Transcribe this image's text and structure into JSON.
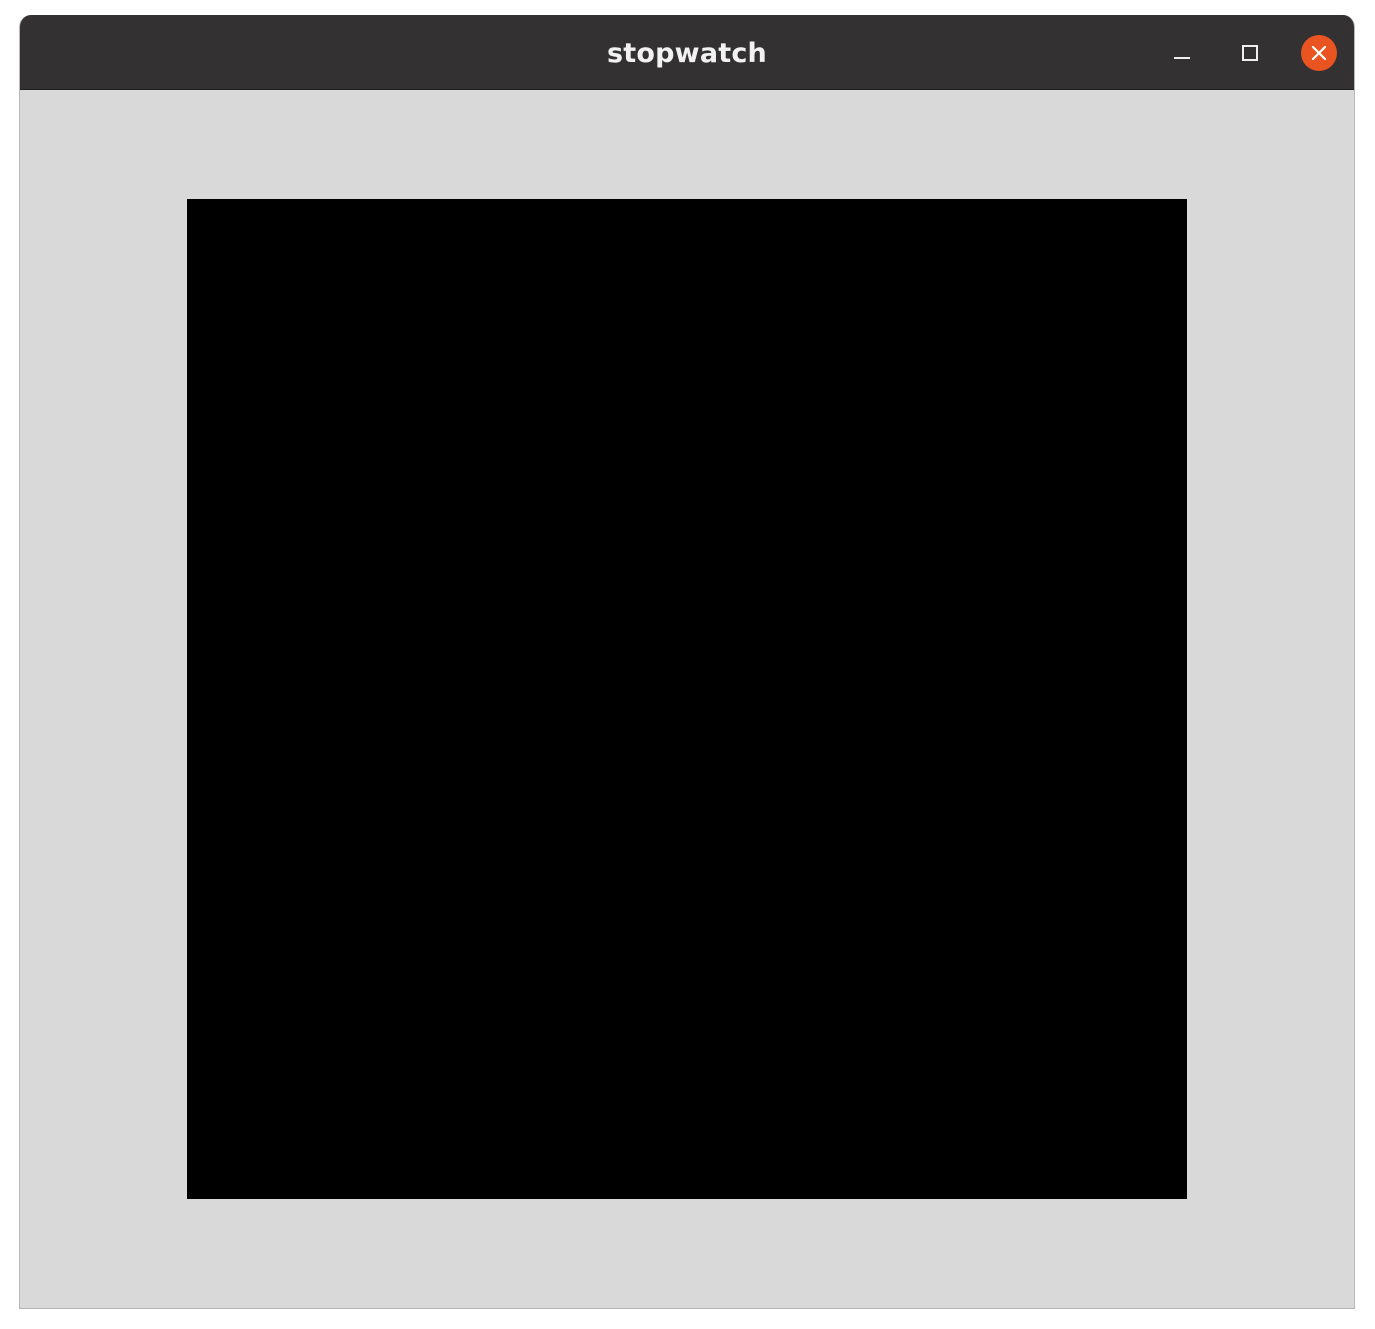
{
  "window": {
    "title": "stopwatch",
    "controls": {
      "minimize_icon": "minimize-icon",
      "maximize_icon": "maximize-icon",
      "close_icon": "close-icon"
    }
  },
  "canvas": {
    "background_color": "#000000"
  },
  "colors": {
    "titlebar": "#333132",
    "window_background": "#d9d9d9",
    "close_accent": "#e95420"
  }
}
